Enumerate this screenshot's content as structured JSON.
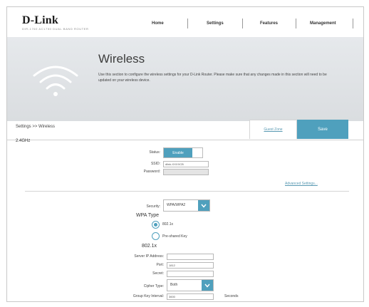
{
  "brand": {
    "name": "D-Link",
    "tagline": "DIR-1760 AC1750 DUAL BAND ROUTER"
  },
  "nav": {
    "items": [
      "Home",
      "Settings",
      "Features",
      "Management"
    ]
  },
  "hero": {
    "title": "Wireless",
    "description": "Use this section to configure the wireless settings for your D-Link Router. Please make sure that any changes made in this section will need to be updated on your wireless device."
  },
  "toolbar": {
    "breadcrumb": "Settings >> Wireless",
    "guest_zone": "Guest Zone",
    "save": "Save"
  },
  "band": {
    "label": "2.4GHz"
  },
  "form": {
    "status_label": "Status:",
    "status_value": "Enable",
    "ssid_label": "SSID:",
    "ssid_value": "dlink-XXXXCB",
    "password_label": "Password:",
    "password_value": "",
    "advanced_link": "Advanced Settings...",
    "security_label": "Security:",
    "security_value": "WPA/WPA2",
    "wpa_type_heading": "WPA Type",
    "wpa_options": [
      "802.1x",
      "Pre-shared Key"
    ],
    "wpa_selected": "802.1x",
    "radius_heading": "802.1x",
    "server_ip_label": "Server IP Address:",
    "server_ip_value": "",
    "port_label": "Port:",
    "port_value": "1812",
    "secret_label": "Secret:",
    "secret_value": "",
    "cipher_label": "Cipher Type:",
    "cipher_value": "Both",
    "group_key_label": "Group Key Interval:",
    "group_key_value": "3600",
    "group_key_unit": "Seconds"
  },
  "colors": {
    "accent": "#4fa0bd",
    "link": "#5a9ab3",
    "hero_bg": "#dfe2e5"
  },
  "icons": {
    "hero": "wifi-icon",
    "dropdown": "chevron-down-icon"
  }
}
